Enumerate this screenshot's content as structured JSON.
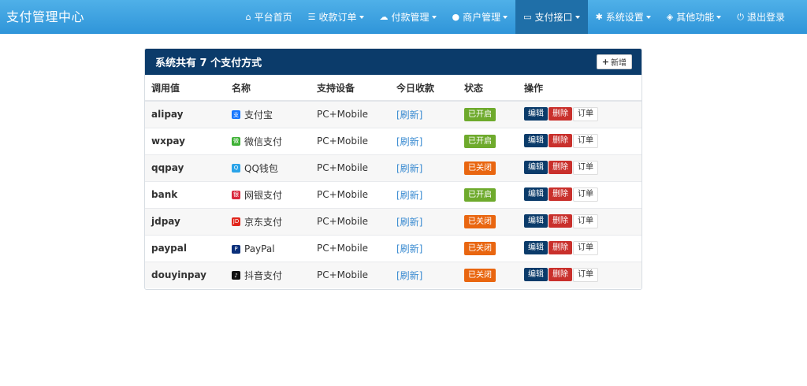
{
  "app": {
    "title": "支付管理中心"
  },
  "nav": [
    {
      "label": "平台首页",
      "icon": "home-icon",
      "caret": false,
      "active": false
    },
    {
      "label": "收款订单",
      "icon": "list-icon",
      "caret": true,
      "active": false
    },
    {
      "label": "付款管理",
      "icon": "cloud-icon",
      "caret": true,
      "active": false
    },
    {
      "label": "商户管理",
      "icon": "user-icon",
      "caret": true,
      "active": false
    },
    {
      "label": "支付接口",
      "icon": "credit-card-icon",
      "caret": true,
      "active": true
    },
    {
      "label": "系统设置",
      "icon": "gear-icon",
      "caret": true,
      "active": false
    },
    {
      "label": "其他功能",
      "icon": "cube-icon",
      "caret": true,
      "active": false
    },
    {
      "label": "退出登录",
      "icon": "power-icon",
      "caret": false,
      "active": false
    }
  ],
  "panel": {
    "title": "系统共有 7 个支付方式",
    "add_label": "新增"
  },
  "table": {
    "headers": [
      "调用值",
      "名称",
      "支持设备",
      "今日收款",
      "状态",
      "操作"
    ],
    "rows": [
      {
        "code": "alipay",
        "name": "支付宝",
        "icon": "alipay-icon",
        "icon_color": "#1677ff",
        "icon_char": "支",
        "device": "PC+Mobile",
        "today": "[刷新]",
        "status": "已开启",
        "status_on": true
      },
      {
        "code": "wxpay",
        "name": "微信支付",
        "icon": "wechat-icon",
        "icon_color": "#3eb135",
        "icon_char": "微",
        "device": "PC+Mobile",
        "today": "[刷新]",
        "status": "已开启",
        "status_on": true
      },
      {
        "code": "qqpay",
        "name": "QQ钱包",
        "icon": "qq-icon",
        "icon_color": "#2aa3e8",
        "icon_char": "Q",
        "device": "PC+Mobile",
        "today": "[刷新]",
        "status": "已关闭",
        "status_on": false
      },
      {
        "code": "bank",
        "name": "网银支付",
        "icon": "unionpay-icon",
        "icon_color": "#d9283e",
        "icon_char": "银",
        "device": "PC+Mobile",
        "today": "[刷新]",
        "status": "已开启",
        "status_on": true
      },
      {
        "code": "jdpay",
        "name": "京东支付",
        "icon": "jd-icon",
        "icon_color": "#e1251b",
        "icon_char": "JD",
        "device": "PC+Mobile",
        "today": "[刷新]",
        "status": "已关闭",
        "status_on": false
      },
      {
        "code": "paypal",
        "name": "PayPal",
        "icon": "paypal-icon",
        "icon_color": "#0a2f7a",
        "icon_char": "P",
        "device": "PC+Mobile",
        "today": "[刷新]",
        "status": "已关闭",
        "status_on": false
      },
      {
        "code": "douyinpay",
        "name": "抖音支付",
        "icon": "douyin-icon",
        "icon_color": "#111111",
        "icon_char": "♪",
        "device": "PC+Mobile",
        "today": "[刷新]",
        "status": "已关闭",
        "status_on": false
      }
    ],
    "actions": {
      "edit": "编辑",
      "delete": "删除",
      "order": "订单"
    }
  },
  "colors": {
    "navbar": "#2f95d9",
    "panel_heading": "#0b3b6a",
    "status_on": "#6eaa2c",
    "status_off": "#e96610",
    "delete": "#c9302c",
    "link": "#3a8bd1"
  }
}
